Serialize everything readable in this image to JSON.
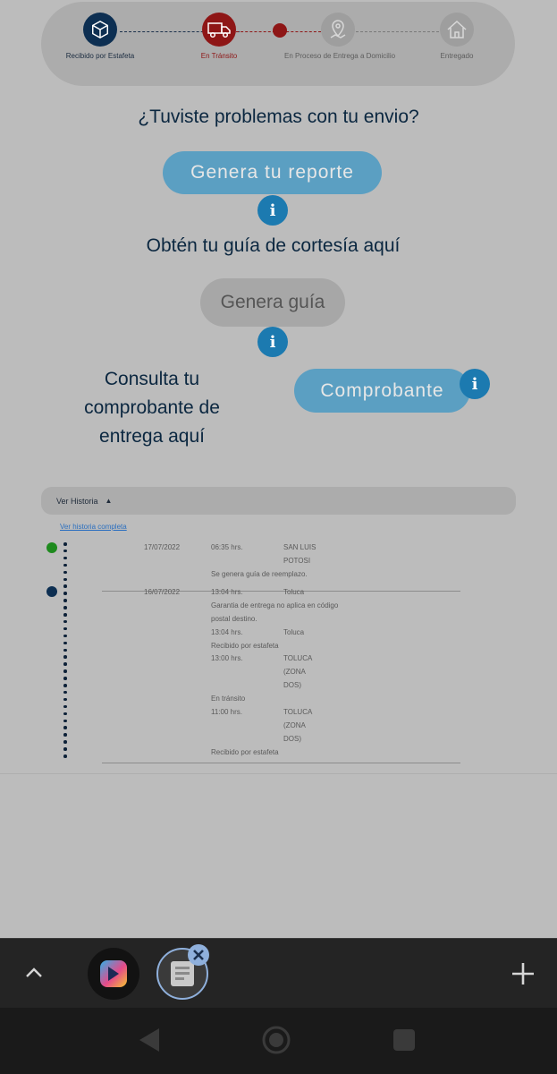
{
  "tracker": {
    "steps": [
      {
        "label": "Recibido por Estafeta",
        "icon": "box-icon"
      },
      {
        "label": "En Tránsito",
        "icon": "truck-icon"
      },
      {
        "label": "En Proceso de Entrega a Domicilio",
        "icon": "map-pin-icon"
      },
      {
        "label": "Entregado",
        "icon": "house-icon"
      }
    ],
    "colors": {
      "done": "#0d2f52",
      "active": "#8e1616",
      "pending": "#9e9e9e"
    }
  },
  "report": {
    "question": "¿Tuviste problemas con tu envio?",
    "button": "Genera tu reporte"
  },
  "courtesy": {
    "question": "Obtén tu guía de cortesía aquí",
    "button": "Genera guía"
  },
  "proof": {
    "line1": "Consulta tu",
    "line2": "comprobante de",
    "line3": "entrega aquí",
    "button": "Comprobante"
  },
  "info_glyph": "i",
  "history": {
    "toggle_label": "Ver Historia",
    "link": "Ver historia completa",
    "entries": [
      {
        "date": "17/07/2022",
        "time": "06:35 hrs.",
        "place1": "SAN LUIS",
        "place2": "POTOSI",
        "desc": "Se genera guía de reemplazo."
      },
      {
        "date": "16/07/2022",
        "time": "13:04 hrs.",
        "place1": "Toluca",
        "desc1": "Garantia de entrega no aplica en código",
        "desc2": "postal destino.",
        "subs": [
          {
            "time": "13:04 hrs.",
            "place": "Toluca",
            "desc": "Recibido por estafeta"
          },
          {
            "time": "13:00 hrs.",
            "place1": "TOLUCA",
            "place2": "(ZONA",
            "place3": "DOS)",
            "desc": "En tránsito"
          },
          {
            "time": "11:00 hrs.",
            "place1": "TOLUCA",
            "place2": "(ZONA",
            "place3": "DOS)",
            "desc": "Recibido por estafeta"
          }
        ]
      }
    ]
  },
  "taskbar": {
    "up_icon": "chevron-up-icon",
    "add_icon": "plus-icon",
    "close_icon": "close-icon"
  },
  "navbar": {
    "back": "back-icon",
    "home": "home-icon",
    "recents": "recents-icon"
  }
}
